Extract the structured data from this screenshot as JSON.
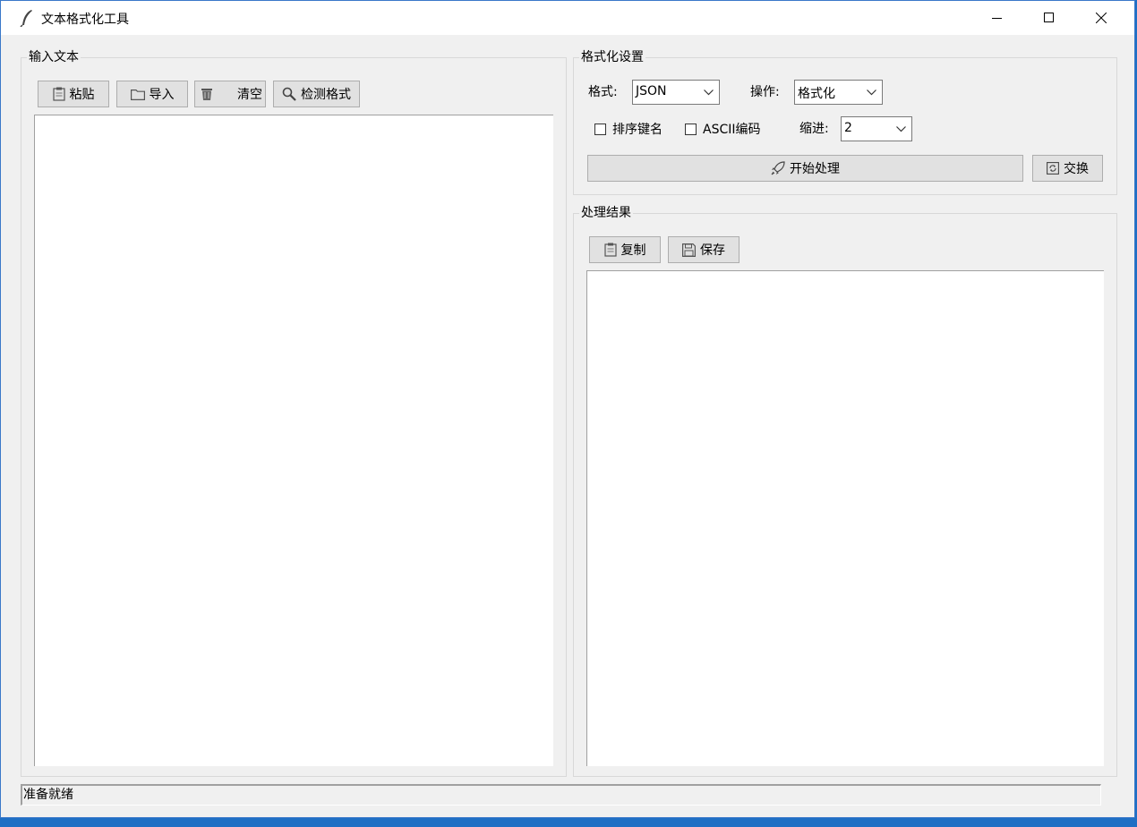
{
  "window": {
    "title": "文本格式化工具"
  },
  "input_group": {
    "title": "输入文本",
    "toolbar": {
      "paste_label": "粘贴",
      "import_label": "导入",
      "clear_label": "清空",
      "detect_label": "检测格式"
    },
    "text": ""
  },
  "settings": {
    "title": "格式化设置",
    "format_label": "格式:",
    "format_value": "JSON",
    "operation_label": "操作:",
    "operation_value": "格式化",
    "sort_keys_label": "排序键名",
    "sort_keys_checked": false,
    "ascii_label": "ASCII编码",
    "ascii_checked": false,
    "indent_label": "缩进:",
    "indent_value": "2",
    "start_label": "开始处理",
    "swap_label": "交换"
  },
  "result_group": {
    "title": "处理结果",
    "copy_label": "复制",
    "save_label": "保存",
    "text": ""
  },
  "status": {
    "text": "准备就绪"
  },
  "icons": {
    "app": "feather-icon",
    "paste": "clipboard-icon",
    "import": "folder-icon",
    "clear": "trash-icon",
    "detect": "magnifier-icon",
    "start": "rocket-icon",
    "swap": "swap-icon",
    "copy": "clipboard-icon",
    "save": "floppy-disk-icon"
  }
}
